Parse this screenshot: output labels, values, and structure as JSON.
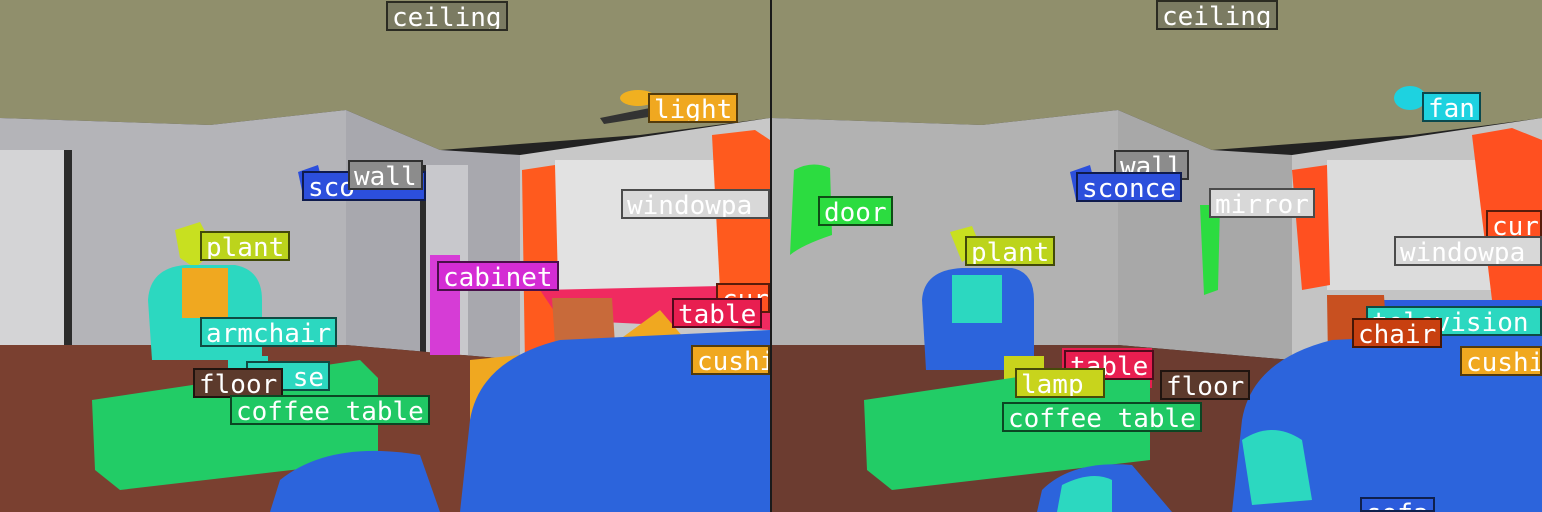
{
  "left_labels": [
    {
      "text": "ceiling",
      "color": "#7b7b62"
    },
    {
      "text": "light",
      "color": "#f0a820"
    },
    {
      "text": "sco",
      "color": "#2c4fdc"
    },
    {
      "text": "wall",
      "color": "#8c8c8c"
    },
    {
      "text": "windowpa",
      "color": "#d8d8d8"
    },
    {
      "text": "plant",
      "color": "#bcd41c"
    },
    {
      "text": "cabinet",
      "color": "#d42cd4"
    },
    {
      "text": "cur",
      "color": "#ff5020"
    },
    {
      "text": "table",
      "color": "#e81e50"
    },
    {
      "text": "armchair",
      "color": "#2cd8c0"
    },
    {
      "text": "cushi",
      "color": "#f0a820"
    },
    {
      "text": "se",
      "color": "#2cd8c0"
    },
    {
      "text": "floor",
      "color": "#5c3a2c"
    },
    {
      "text": "coffee table",
      "color": "#20c864"
    }
  ],
  "right_labels": [
    {
      "text": "ceiling",
      "color": "#7b7b62"
    },
    {
      "text": "fan",
      "color": "#1ed2e0"
    },
    {
      "text": "wall",
      "color": "#8c8c8c"
    },
    {
      "text": "sconce",
      "color": "#2c4fdc"
    },
    {
      "text": "mirror",
      "color": "#d8d8d8"
    },
    {
      "text": "door",
      "color": "#2cdc40"
    },
    {
      "text": "cur",
      "color": "#ff5020"
    },
    {
      "text": "plant",
      "color": "#bcd41c"
    },
    {
      "text": "windowpa",
      "color": "#d8d8d8"
    },
    {
      "text": "television r",
      "color": "#2cd8c0"
    },
    {
      "text": "chair",
      "color": "#c84010"
    },
    {
      "text": "table",
      "color": "#e81e50"
    },
    {
      "text": "cushi",
      "color": "#f0a820"
    },
    {
      "text": "lamp",
      "color": "#c8d41c"
    },
    {
      "text": "floor",
      "color": "#5c3a2c"
    },
    {
      "text": "coffee table",
      "color": "#20c864"
    },
    {
      "text": "sofa",
      "color": "#2c5cdc"
    }
  ]
}
